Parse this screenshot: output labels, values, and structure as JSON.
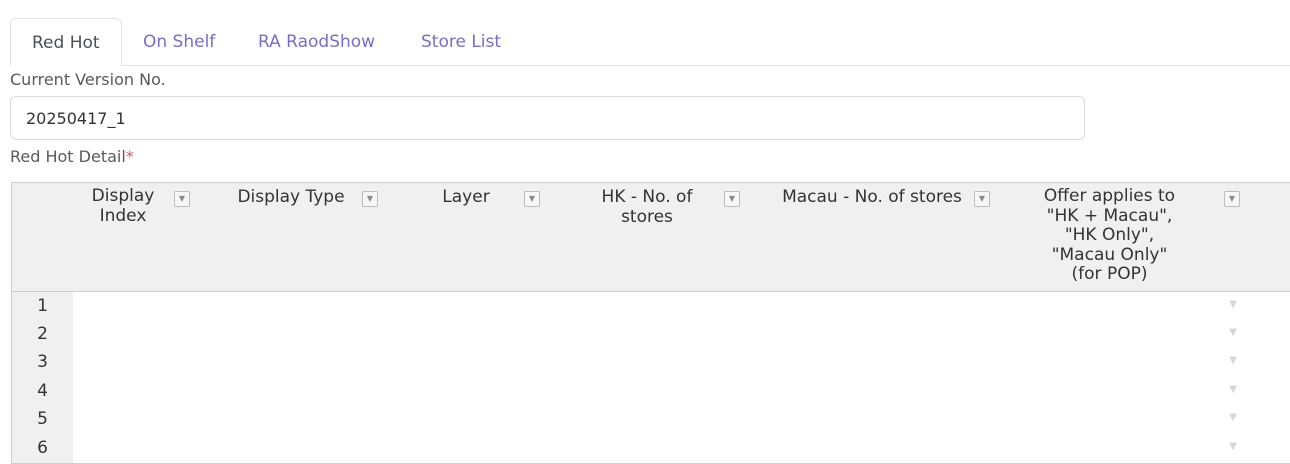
{
  "tabs": [
    {
      "label": "Red Hot",
      "active": true
    },
    {
      "label": "On Shelf",
      "active": false
    },
    {
      "label": "RA RaodShow",
      "active": false
    },
    {
      "label": "Store List",
      "active": false
    }
  ],
  "version": {
    "label": "Current Version No.",
    "value": "20250417_1"
  },
  "detail": {
    "label": "Red Hot Detail",
    "required_mark": "*"
  },
  "table": {
    "columns": [
      "Display Index",
      "Display Type",
      "Layer",
      "HK - No. of stores",
      "Macau - No. of stores",
      "Offer applies to \"HK + Macau\", \"HK Only\", \"Macau Only\" (for POP)"
    ],
    "rows": [
      "1",
      "2",
      "3",
      "4",
      "5",
      "6"
    ],
    "filter_icon": "filter-dropdown-icon",
    "dropdown_icon": "caret-down-icon"
  },
  "colors": {
    "tab_link": "#7b6cc7",
    "header_bg": "#f0f0f0",
    "grid_line": "#cfcfcf",
    "required": "#e55353"
  }
}
